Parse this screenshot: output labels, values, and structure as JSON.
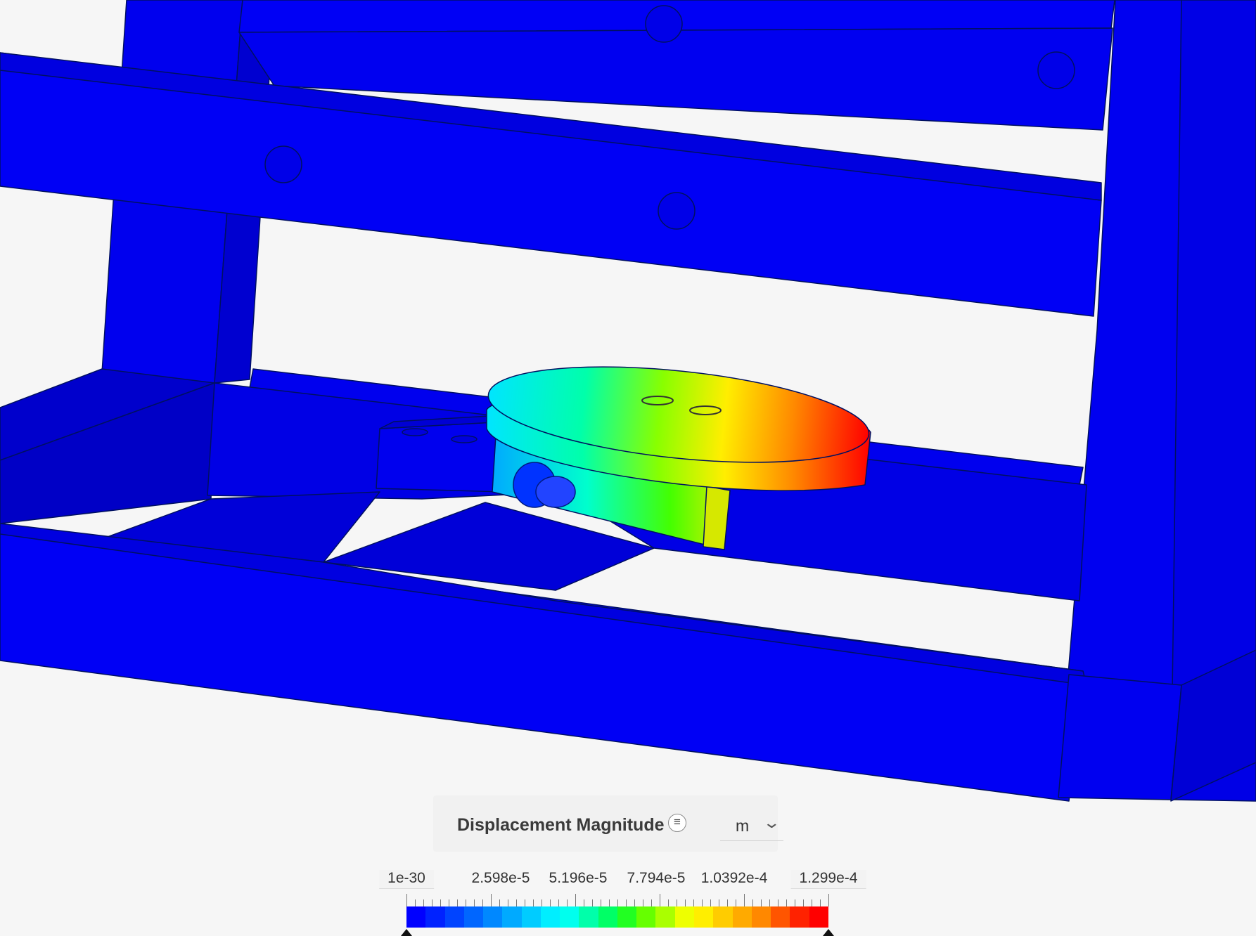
{
  "legend": {
    "title": "Displacement Magnitude",
    "menu_icon": "≡",
    "unit": "m",
    "chevron": "⌄",
    "tick_labels": [
      "1e-30",
      "2.598e-5",
      "5.196e-5",
      "7.794e-5",
      "1.0392e-4",
      "1.299e-4"
    ]
  },
  "colors": {
    "structure": "#0000f5",
    "background": "#f6f6f6",
    "scale": [
      "#0000ff",
      "#0022ff",
      "#0044ff",
      "#0066ff",
      "#0088ff",
      "#00aaff",
      "#00ccff",
      "#00eeff",
      "#00ffee",
      "#00ffaa",
      "#00ff66",
      "#22ff22",
      "#66ff00",
      "#aaff00",
      "#eeff00",
      "#ffee00",
      "#ffcc00",
      "#ffaa00",
      "#ff8800",
      "#ff5500",
      "#ff2200",
      "#ff0000"
    ]
  }
}
